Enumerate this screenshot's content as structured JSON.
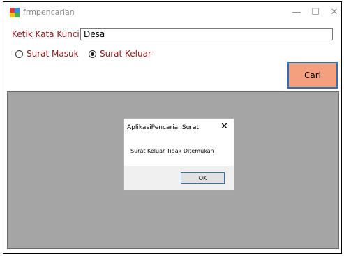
{
  "window": {
    "title": "frmpencarian",
    "controls": {
      "minimize": "—",
      "maximize": "☐",
      "close": "✕"
    }
  },
  "search": {
    "label": "Ketik Kata Kunci",
    "value": "Desa"
  },
  "radios": [
    {
      "label": "Surat Masuk",
      "checked": false
    },
    {
      "label": "Surat Keluar",
      "checked": true
    }
  ],
  "cari_button": {
    "label": "Cari",
    "color": "#f4a07e"
  },
  "dialog": {
    "title": "AplikasiPencarianSurat",
    "close": "✕",
    "message": "Surat Keluar Tidak Ditemukan",
    "ok_label": "OK"
  },
  "colors": {
    "label_text": "#8b1a1a",
    "panel_bg": "#a5a5a5",
    "focus_border": "#2f6fb6"
  }
}
